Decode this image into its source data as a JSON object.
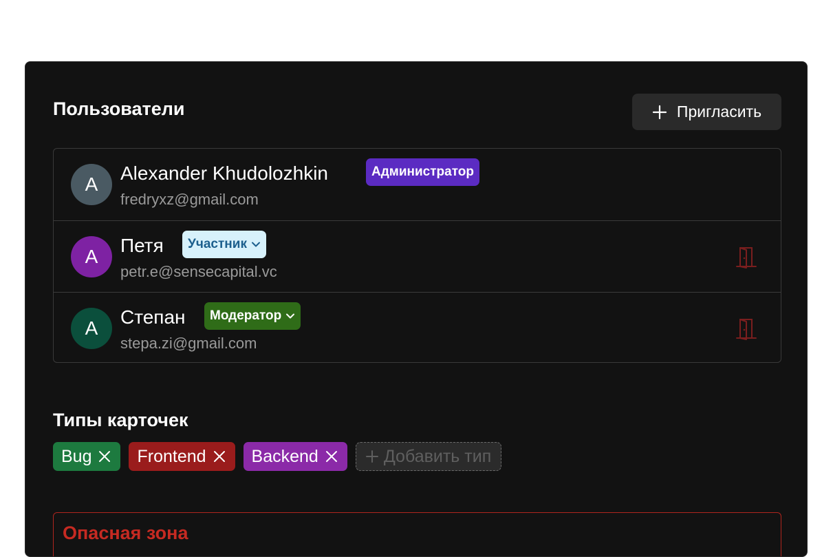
{
  "users_section": {
    "title": "Пользователи",
    "invite_label": "Пригласить",
    "users": [
      {
        "initial": "A",
        "name": "Alexander Khudolozhkin",
        "email": "fredryxz@gmail.com",
        "role": "Администратор",
        "avatar_color": "#4a5a63",
        "role_bg": "#5b2bc2",
        "role_fg": "#ffffff"
      },
      {
        "initial": "A",
        "name": "Петя",
        "email": "petr.e@sensecapital.vc",
        "role": "Участник",
        "avatar_color": "#7e22a3",
        "role_bg": "#d7f1fb",
        "role_fg": "#1c5f8d"
      },
      {
        "initial": "A",
        "name": "Степан",
        "email": "stepa.zi@gmail.com",
        "role": "Модератор",
        "avatar_color": "#0b4f3c",
        "role_bg": "#2f6c18",
        "role_fg": "#ffffff"
      }
    ]
  },
  "card_types_section": {
    "title": "Типы карточек",
    "types": [
      {
        "label": "Bug",
        "color": "#1d7a3f"
      },
      {
        "label": "Frontend",
        "color": "#9a1c1c"
      },
      {
        "label": "Backend",
        "color": "#8b2aa8"
      }
    ],
    "add_label": "Добавить тип"
  },
  "danger_zone": {
    "title": "Опасная зона"
  },
  "icons": {
    "invite": "plus-icon",
    "role_dropdown": "chevron-down-icon",
    "leave": "door-exit-icon",
    "remove_type": "close-icon",
    "add_type": "plus-icon"
  },
  "colors": {
    "panel_bg": "#121212",
    "leave_icon": "#7a1e1e",
    "danger": "#c62a22"
  }
}
